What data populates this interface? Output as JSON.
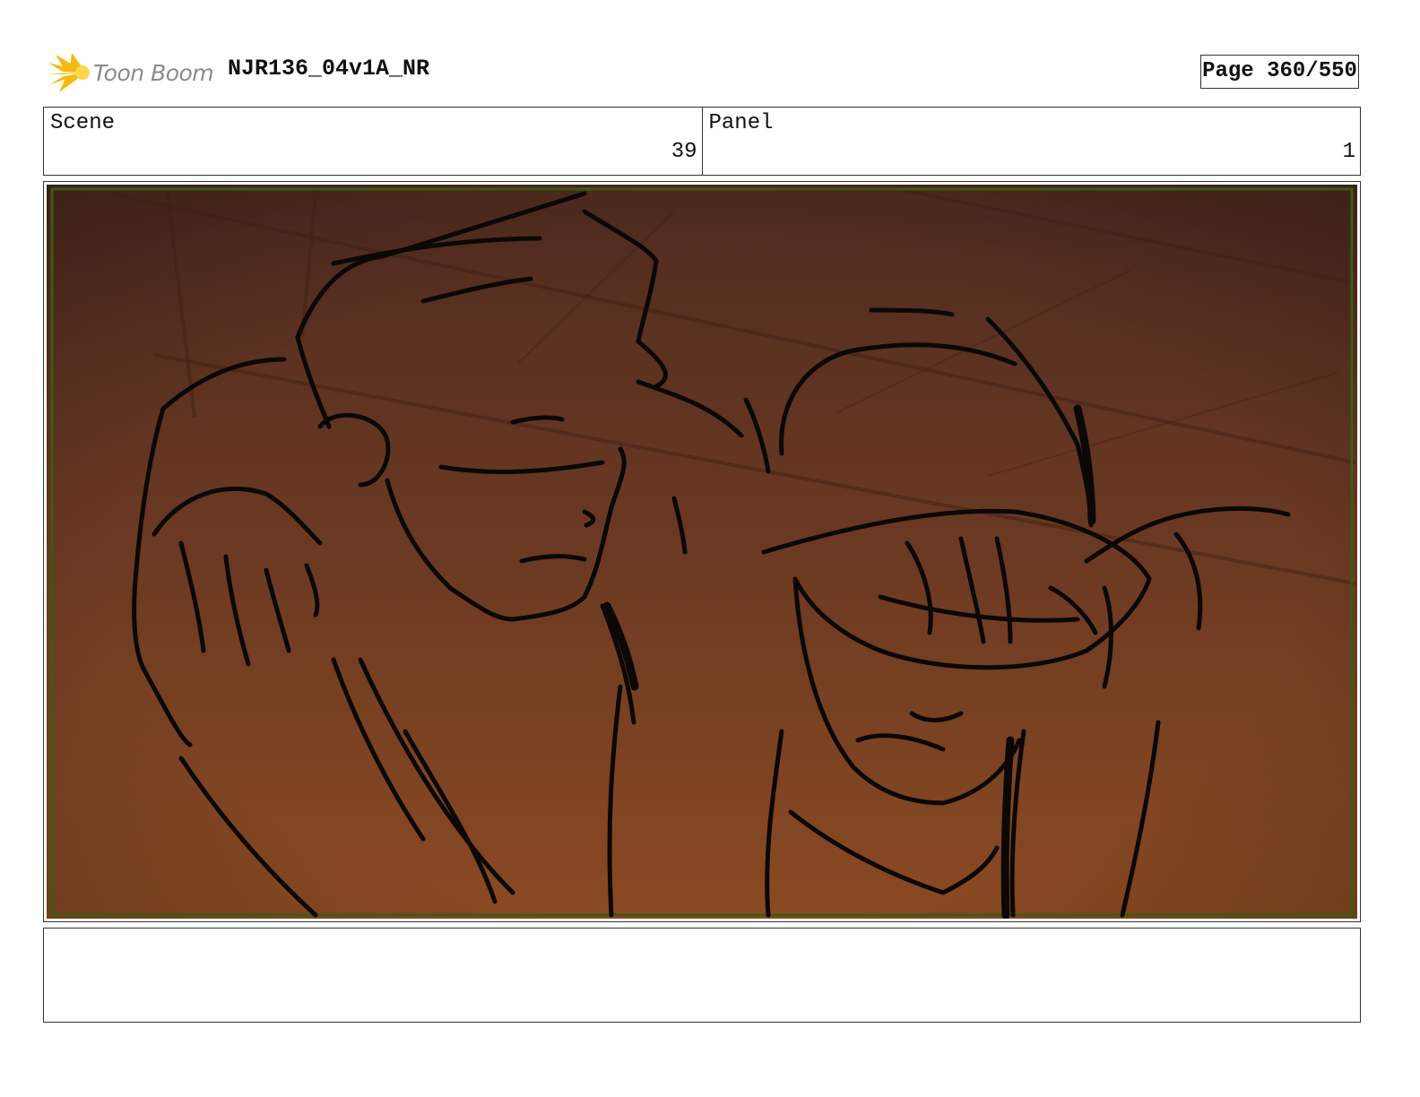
{
  "header": {
    "logo_text": "Toon Boom",
    "document_title": "NJR136_04v1A_NR",
    "page_indicator": "Page 360/550"
  },
  "info": {
    "scene_label": "Scene",
    "scene_value": "39",
    "panel_label": "Panel",
    "panel_value": "1"
  },
  "colors": {
    "logo_star": "#f5b90f",
    "sky_top": "#4f2b20",
    "sky_bottom": "#8a4a22",
    "frame_border": "#3e5a12",
    "ink": "#0b0806"
  }
}
